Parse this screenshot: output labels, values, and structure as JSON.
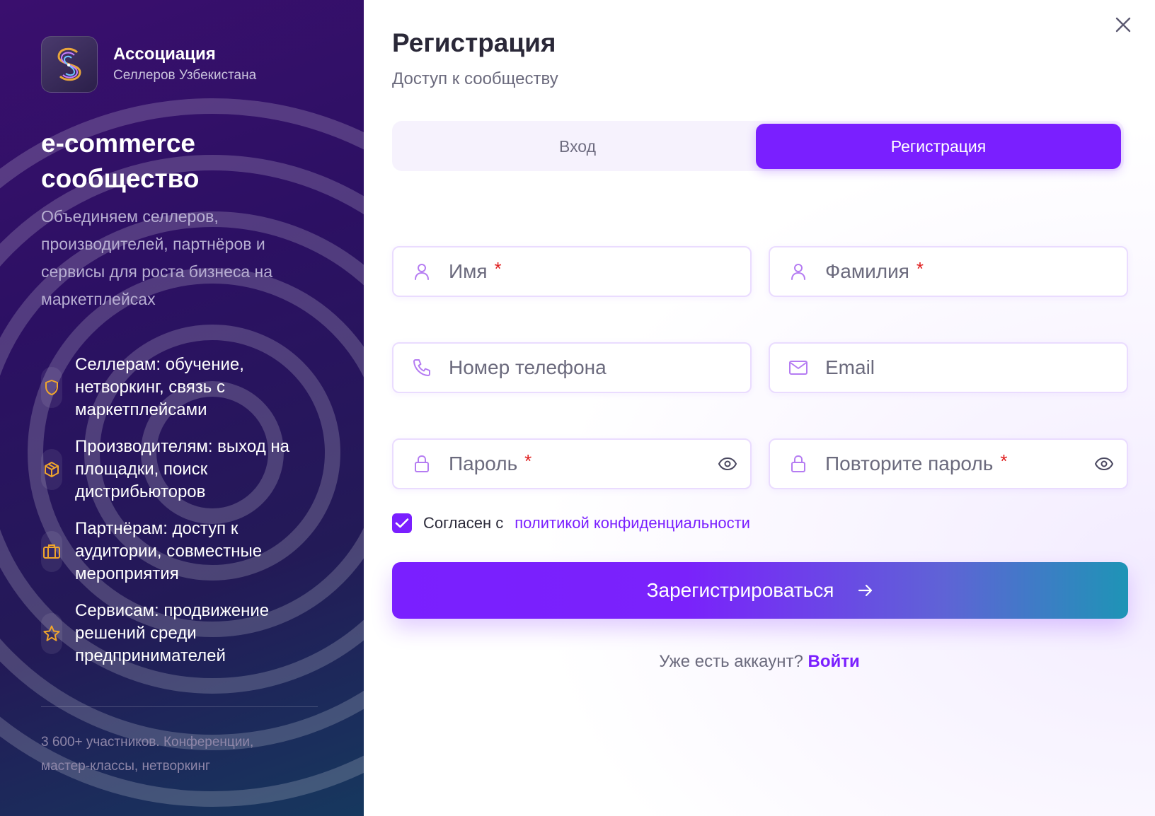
{
  "brand": {
    "name": "Ассоциация",
    "subtitle": "Селлеров Узбекистана"
  },
  "promo": {
    "headline": "e-commerce сообщество",
    "lead": "Объединяем селлеров, производителей, партнёров и сервисы для роста бизнеса на маркетплейсах",
    "features": [
      {
        "icon": "shield-icon",
        "text": "Селлерам: обучение, нетворкинг, связь с маркетплейсами"
      },
      {
        "icon": "box-icon",
        "text": "Производителям: выход на площадки, поиск дистрибьюторов"
      },
      {
        "icon": "briefcase-icon",
        "text": "Партнёрам: доступ к аудитории, совместные мероприятия"
      },
      {
        "icon": "star-icon",
        "text": "Сервисам: продвижение решений среди предпринимателей"
      }
    ],
    "footnote": "3 600+ участников. Конференции, мастер-классы, нетворкинг"
  },
  "form": {
    "title": "Регистрация",
    "subtitle": "Доступ к сообществу",
    "tabs": {
      "login": "Вход",
      "register": "Регистрация",
      "active": "register"
    },
    "fields": {
      "first_name": {
        "placeholder": "Имя",
        "required_mark": "*",
        "icon": "user-icon"
      },
      "last_name": {
        "placeholder": "Фамилия",
        "required_mark": "*",
        "icon": "user-icon"
      },
      "phone": {
        "placeholder": "Номер телефона",
        "icon": "phone-icon"
      },
      "email": {
        "placeholder": "Email",
        "icon": "mail-icon"
      },
      "password": {
        "placeholder": "Пароль",
        "required_mark": "*",
        "icon": "lock-icon"
      },
      "password_repeat": {
        "placeholder": "Повторите пароль",
        "required_mark": "*",
        "icon": "lock-icon"
      }
    },
    "agree": {
      "checked": true,
      "text": "Согласен с",
      "link": "политикой конфиденциальности"
    },
    "submit_label": "Зарегистрироваться",
    "have_account_text": "Уже есть аккаунт?",
    "login_link": "Войти"
  },
  "colors": {
    "accent": "#7a1fff",
    "required": "#e02020",
    "left_panel_dark": "#2c1063"
  }
}
